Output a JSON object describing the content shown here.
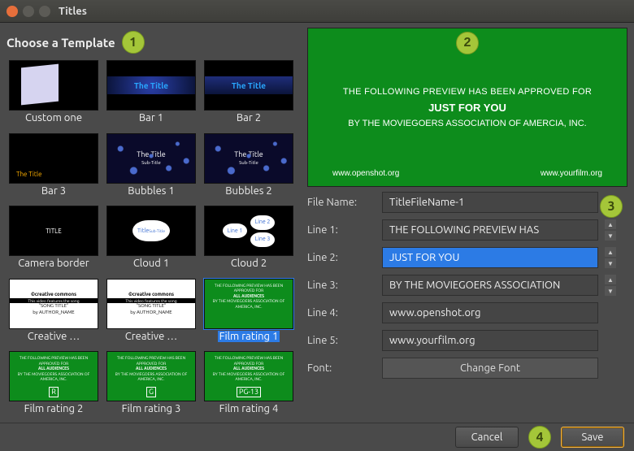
{
  "window": {
    "title": "Titles"
  },
  "left": {
    "heading": "Choose a Template",
    "templates": [
      {
        "name": "Custom one"
      },
      {
        "name": "Bar 1"
      },
      {
        "name": "Bar 2"
      },
      {
        "name": "Bar 3"
      },
      {
        "name": "Bubbles 1"
      },
      {
        "name": "Bubbles 2"
      },
      {
        "name": "Camera border"
      },
      {
        "name": "Cloud 1"
      },
      {
        "name": "Cloud 2"
      },
      {
        "name": "Creative …"
      },
      {
        "name": "Creative …"
      },
      {
        "name": "Film rating 1"
      },
      {
        "name": "Film rating 2"
      },
      {
        "name": "Film rating 3"
      },
      {
        "name": "Film rating 4"
      }
    ],
    "thumb_labels": {
      "bar_title": "The Title",
      "bubbles_title": "The Title",
      "bubbles_sub": "Sub-Title",
      "camera_title": "TITLE",
      "cloud_title": "Title",
      "cloud_sub": "Sub-Title",
      "cloud2_l1": "Line 1",
      "cloud2_l2": "Line 2",
      "cloud2_l3": "Line 3",
      "cc_logo": "©creative commons",
      "film_top": "THE FOLLOWING PREVIEW HAS BEEN APPROVED FOR",
      "film_aud": "ALL AUDIENCES",
      "film_by": "BY THE MOVIEGOERS ASSOCIATION OF AMERICA, INC.",
      "rating_r": "R",
      "rating_g": "G",
      "rating_pg13": "PG-13"
    }
  },
  "preview": {
    "line1": "THE FOLLOWING PREVIEW HAS BEEN APPROVED FOR",
    "line2": "JUST FOR YOU",
    "line3": "BY THE MOVIEGOERS ASSOCIATION OF AMERCIA, INC.",
    "url_left": "www.openshot.org",
    "url_right": "www.yourfilm.org"
  },
  "form": {
    "labels": {
      "filename": "File Name:",
      "line1": "Line 1:",
      "line2": "Line 2:",
      "line3": "Line 3:",
      "line4": "Line 4:",
      "line5": "Line 5:",
      "font": "Font:"
    },
    "values": {
      "filename": "TitleFileName-1",
      "line1": "THE FOLLOWING PREVIEW HAS",
      "line2": "JUST FOR YOU",
      "line3": "BY THE MOVIEGOERS ASSOCIATION",
      "line4": "www.openshot.org",
      "line5": "www.yourfilm.org"
    },
    "font_button": "Change Font"
  },
  "buttons": {
    "cancel": "Cancel",
    "save": "Save"
  },
  "badges": {
    "b1": "1",
    "b2": "2",
    "b3": "3",
    "b4": "4"
  }
}
